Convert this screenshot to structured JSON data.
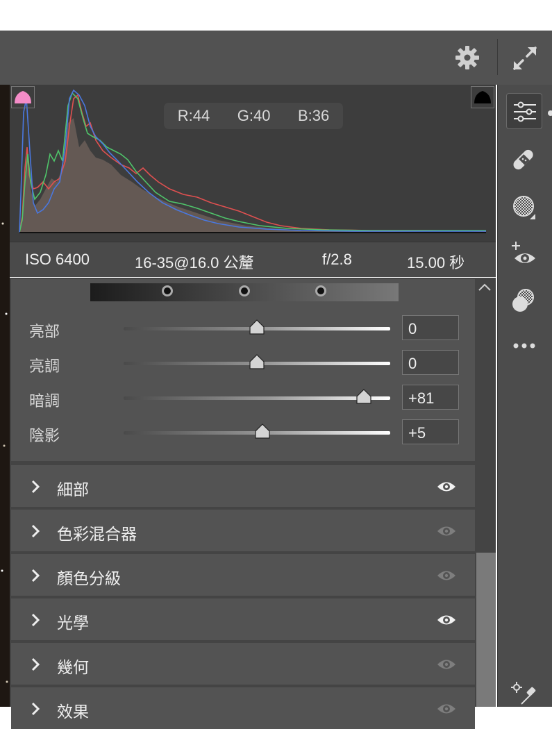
{
  "histogram": {
    "readout": {
      "r_label": "R:",
      "r_value": "44",
      "g_label": "G:",
      "g_value": "40",
      "b_label": "B:",
      "b_value": "36"
    },
    "colors": {
      "red": "#e05050",
      "green": "#4fc46a",
      "blue": "#4a78e0",
      "shadow_clip": "#f48cc8",
      "highlight_clip": "#000000"
    }
  },
  "metadata": {
    "iso": "ISO 6400",
    "lens": "16-35@16.0 公釐",
    "aperture": "f/2.8",
    "shutter": "15.00 秒"
  },
  "tone_sliders": [
    {
      "label": "亮部",
      "value": "0",
      "position": 0.5
    },
    {
      "label": "亮調",
      "value": "0",
      "position": 0.5
    },
    {
      "label": "暗調",
      "value": "+81",
      "position": 0.905
    },
    {
      "label": "陰影",
      "value": "+5",
      "position": 0.52
    }
  ],
  "sections": [
    {
      "title": "細部",
      "eye_visible": true
    },
    {
      "title": "色彩混合器",
      "eye_visible": false
    },
    {
      "title": "顏色分級",
      "eye_visible": false
    },
    {
      "title": "光學",
      "eye_visible": true
    },
    {
      "title": "幾何",
      "eye_visible": false
    },
    {
      "title": "效果",
      "eye_visible": false
    }
  ],
  "sidebar_tools": [
    "sliders-icon",
    "healing-bandage-icon",
    "masking-icon",
    "red-eye-icon",
    "presets-icon",
    "more-icon",
    "eyedropper-icon"
  ],
  "topbar_icons": [
    "gear-icon",
    "expand-icon"
  ]
}
